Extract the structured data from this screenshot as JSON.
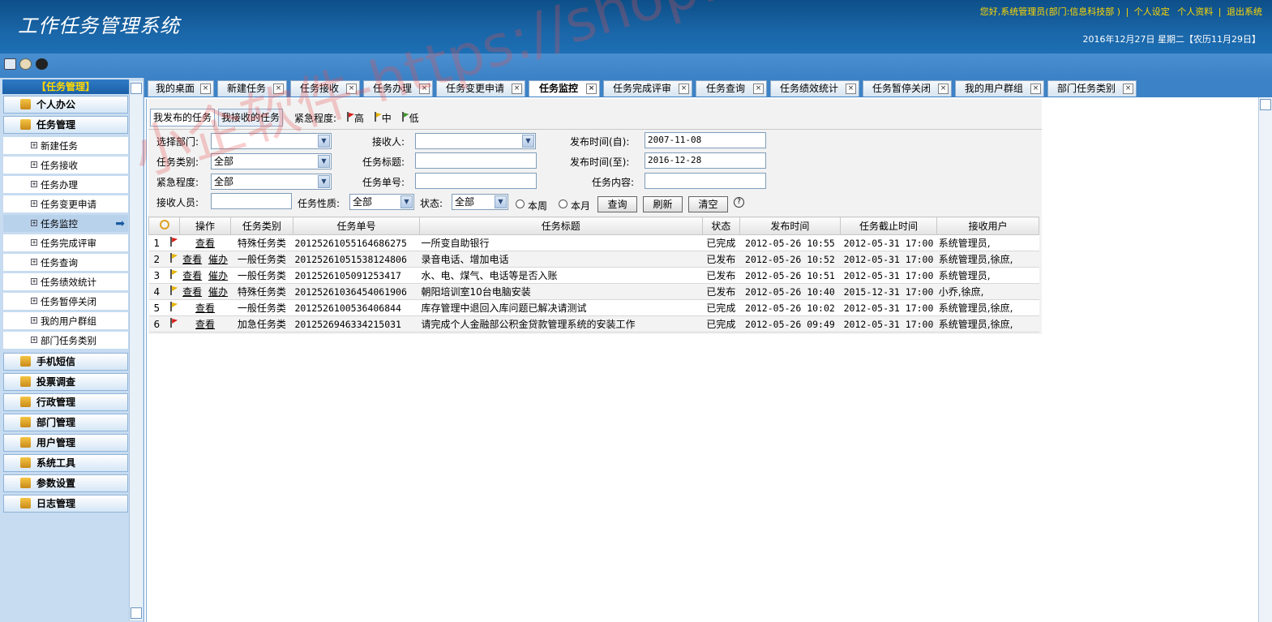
{
  "header": {
    "app_title": "工作任务管理系统",
    "greeting": "您好,系统管理员(部门:信息科技部 )",
    "link_settings": "个人设定",
    "link_profile": "个人资料",
    "link_logout": "退出系统",
    "date": "2016年12月27日 星期二【农历11月29日】"
  },
  "sidebar": {
    "header": "【任务管理】",
    "groups_top": [
      {
        "label": "个人办公",
        "icon": "pencil-icon"
      },
      {
        "label": "任务管理",
        "icon": "document-icon"
      }
    ],
    "items": [
      {
        "label": "新建任务"
      },
      {
        "label": "任务接收"
      },
      {
        "label": "任务办理"
      },
      {
        "label": "任务变更申请"
      },
      {
        "label": "任务监控",
        "active": true
      },
      {
        "label": "任务完成评审"
      },
      {
        "label": "任务查询"
      },
      {
        "label": "任务绩效统计"
      },
      {
        "label": "任务暂停关闭"
      },
      {
        "label": "我的用户群组"
      },
      {
        "label": "部门任务类别"
      }
    ],
    "groups_bottom": [
      {
        "label": "手机短信",
        "icon": "phone-icon"
      },
      {
        "label": "投票调查",
        "icon": "clipboard-icon"
      },
      {
        "label": "行政管理",
        "icon": "ruler-icon"
      },
      {
        "label": "部门管理",
        "icon": "stamp-icon"
      },
      {
        "label": "用户管理",
        "icon": "user-icon"
      },
      {
        "label": "系统工具",
        "icon": "tools-icon"
      },
      {
        "label": "参数设置",
        "icon": "key-icon"
      },
      {
        "label": "日志管理",
        "icon": "calendar-icon"
      }
    ]
  },
  "tabs": [
    {
      "label": "我的桌面"
    },
    {
      "label": "新建任务"
    },
    {
      "label": "任务接收"
    },
    {
      "label": "任务办理"
    },
    {
      "label": "任务变更申请"
    },
    {
      "label": "任务监控",
      "active": true
    },
    {
      "label": "任务完成评审"
    },
    {
      "label": "任务查询"
    },
    {
      "label": "任务绩效统计"
    },
    {
      "label": "任务暂停关闭"
    },
    {
      "label": "我的用户群组"
    },
    {
      "label": "部门任务类别"
    }
  ],
  "subtabs": {
    "published": "我发布的任务",
    "received": "我接收的任务"
  },
  "urgency": {
    "label": "紧急程度:",
    "high": "高",
    "mid": "中",
    "low": "低",
    "high_color": "#d8201c",
    "mid_color": "#e8b400",
    "low_color": "#3c9a2a"
  },
  "filters": {
    "dept_label": "选择部门:",
    "receiver_label": "接收人:",
    "pub_from_label": "发布时间(自):",
    "pub_from_value": "2007-11-08",
    "type_label": "任务类别:",
    "type_value": "全部",
    "title_label": "任务标题:",
    "pub_to_label": "发布时间(至):",
    "pub_to_value": "2016-12-28",
    "urgency_label": "紧急程度:",
    "urgency_value": "全部",
    "number_label": "任务单号:",
    "content_label": "任务内容:",
    "receivers_label": "接收人员:",
    "nature_label": "任务性质:",
    "nature_value": "全部",
    "status_label": "状态:",
    "status_value": "全部",
    "week_label": "本周",
    "month_label": "本月",
    "query_btn": "查询",
    "refresh_btn": "刷新",
    "clear_btn": "清空",
    "help": "?"
  },
  "grid": {
    "columns": [
      "",
      "操作",
      "任务类别",
      "任务单号",
      "任务标题",
      "状态",
      "发布时间",
      "任务截止时间",
      "接收用户"
    ],
    "rows": [
      {
        "no": "1",
        "flag": "high",
        "view": "查看",
        "urge": "",
        "type": "特殊任务类",
        "number": "20125261055164686275",
        "title": "一所变自助银行",
        "status": "已完成",
        "published": "2012-05-26 10:55",
        "deadline": "2012-05-31 17:00",
        "receivers": "系统管理员,"
      },
      {
        "no": "2",
        "flag": "mid",
        "view": "查看",
        "urge": "催办",
        "type": "一般任务类",
        "number": "20125261051538124806",
        "title": "录音电话、增加电话",
        "status": "已发布",
        "published": "2012-05-26 10:52",
        "deadline": "2012-05-31 17:00",
        "receivers": "系统管理员,徐庶,"
      },
      {
        "no": "3",
        "flag": "mid",
        "view": "查看",
        "urge": "催办",
        "type": "一般任务类",
        "number": "2012526105091253417",
        "title": "水、电、煤气、电话等是否入账",
        "status": "已发布",
        "published": "2012-05-26 10:51",
        "deadline": "2012-05-31 17:00",
        "receivers": "系统管理员,"
      },
      {
        "no": "4",
        "flag": "mid",
        "view": "查看",
        "urge": "催办",
        "type": "特殊任务类",
        "number": "20125261036454061906",
        "title": "朝阳培训室10台电脑安装",
        "status": "已发布",
        "published": "2012-05-26 10:40",
        "deadline": "2015-12-31 17:00",
        "receivers": "小乔,徐庶,"
      },
      {
        "no": "5",
        "flag": "mid",
        "view": "查看",
        "urge": "",
        "type": "一般任务类",
        "number": "2012526100536406844",
        "title": "库存管理中退回入库问题已解决请测试",
        "status": "已完成",
        "published": "2012-05-26 10:02",
        "deadline": "2012-05-31 17:00",
        "receivers": "系统管理员,徐庶,"
      },
      {
        "no": "6",
        "flag": "high",
        "view": "查看",
        "urge": "",
        "type": "加急任务类",
        "number": "2012526946334215031",
        "title": "请完成个人金融部公积金贷款管理系统的安装工作",
        "status": "已完成",
        "published": "2012-05-26 09:49",
        "deadline": "2012-05-31 17:00",
        "receivers": "系统管理员,徐庶,"
      }
    ]
  },
  "watermark": "小企软件-https://shop113983775.taobao.com"
}
